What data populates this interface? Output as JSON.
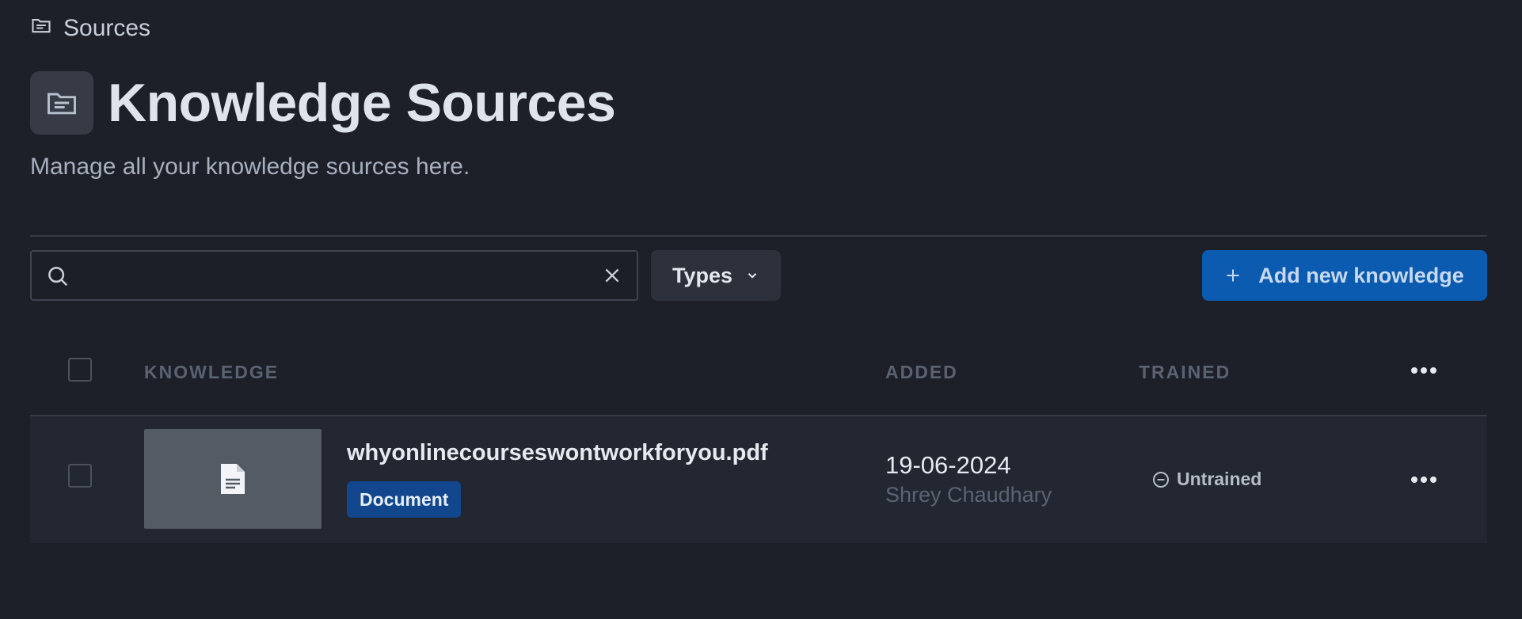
{
  "breadcrumb": {
    "label": "Sources",
    "icon": "folder-icon"
  },
  "header": {
    "title": "Knowledge Sources",
    "subtitle": "Manage all your knowledge sources here.",
    "icon": "folder-icon"
  },
  "toolbar": {
    "search_value": "",
    "search_placeholder": "",
    "types_label": "Types",
    "add_label": "Add new knowledge"
  },
  "table": {
    "columns": {
      "knowledge": "KNOWLEDGE",
      "added": "ADDED",
      "trained": "TRAINED"
    },
    "rows": [
      {
        "file_name": "whyonlinecourseswontworkforyou.pdf",
        "type_badge": "Document",
        "added_date": "19-06-2024",
        "added_by": "Shrey Chaudhary",
        "status": "Untrained"
      }
    ]
  },
  "colors": {
    "background": "#1d2029",
    "accent": "#0b5cb0",
    "badge": "#12468d"
  }
}
